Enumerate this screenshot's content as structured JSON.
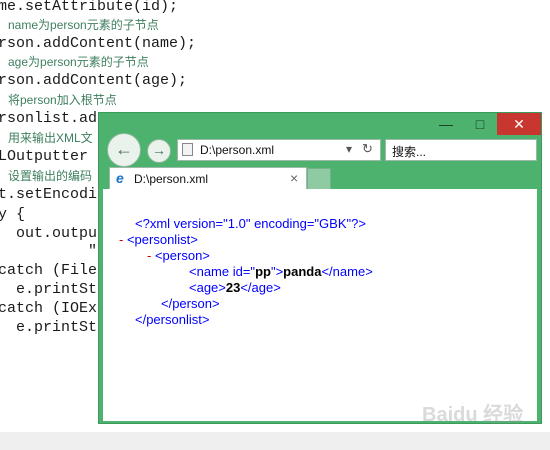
{
  "code": {
    "lines": [
      "me.setAttribute(id);",
      "rson.addContent(name);",
      "rson.addContent(age);",
      "rsonlist.ad",
      "LOutputter",
      "t.setEncodi",
      "y {",
      "  out.outpu",
      "          \"",
      "catch (File",
      "  e.printSt",
      "catch (IOEx",
      "  e.printSt"
    ],
    "comments": [
      "name为person元素的子节点",
      "age为person元素的子节点",
      "将person加入根节点",
      "用来输出XML文",
      "设置输出的编码"
    ]
  },
  "browser": {
    "address": "D:\\person.xml",
    "search_placeholder": "搜索...",
    "tab_title": "D:\\person.xml",
    "minimize": "—",
    "maximize": "□",
    "close": "✕",
    "back": "←",
    "forward": "→",
    "dropdown": "▾",
    "refresh": "↻",
    "tab_close": "×"
  },
  "xml": {
    "declaration": "<?xml version=\"1.0\" encoding=\"GBK\"?>",
    "collapse": "-",
    "personlist_open": "<personlist>",
    "person_open": "<person>",
    "name_open_pre": "<name id=\"",
    "name_id": "pp",
    "name_open_post": "\">",
    "name_value": "panda",
    "name_close": "</name>",
    "age_open": "<age>",
    "age_value": "23",
    "age_close": "</age>",
    "person_close": "</person>",
    "personlist_close": "</personlist>"
  },
  "watermark": "Baidu 经验"
}
